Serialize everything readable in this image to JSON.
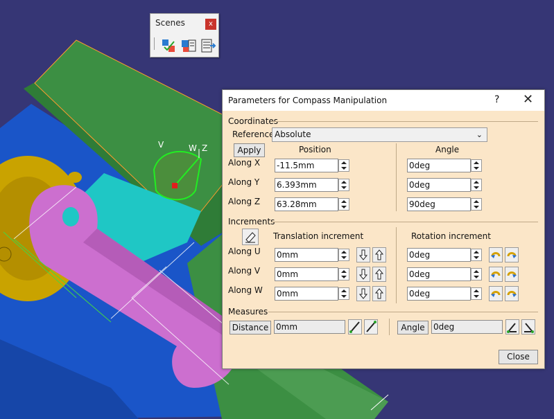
{
  "colors": {
    "background": "#363675",
    "dialog_bg": "#fbe6c8",
    "part_green": "#3c8f43",
    "part_blue": "#1a55c8",
    "part_pink": "#cc6fcf",
    "part_cyan": "#1fc7c5",
    "part_yellow": "#c9a300",
    "compass_green": "#22ee22"
  },
  "viewport": {
    "compass_labels": {
      "v": "V",
      "w": "W",
      "z": "Z"
    }
  },
  "scenes": {
    "title": "Scenes",
    "close": "x",
    "tools": [
      "scene-create-icon",
      "scene-edit-icon",
      "scene-list-icon"
    ]
  },
  "dialog": {
    "title": "Parameters for Compass Manipulation",
    "help": "?",
    "close": "✕",
    "coordinates": {
      "section": "Coordinates",
      "reference_label": "Reference",
      "reference_value": "Absolute",
      "apply": "Apply",
      "position_header": "Position",
      "angle_header": "Angle",
      "rows": [
        {
          "label": "Along X",
          "position": "-11.5mm",
          "angle": "0deg"
        },
        {
          "label": "Along Y",
          "position": "6.393mm",
          "angle": "0deg"
        },
        {
          "label": "Along Z",
          "position": "63.28mm",
          "angle": "90deg"
        }
      ]
    },
    "increments": {
      "section": "Increments",
      "translation_header": "Translation increment",
      "rotation_header": "Rotation increment",
      "rows": [
        {
          "label": "Along U",
          "translation": "0mm",
          "rotation": "0deg"
        },
        {
          "label": "Along V",
          "translation": "0mm",
          "rotation": "0deg"
        },
        {
          "label": "Along W",
          "translation": "0mm",
          "rotation": "0deg"
        }
      ]
    },
    "measures": {
      "section": "Measures",
      "distance_button": "Distance",
      "distance_value": "0mm",
      "angle_button": "Angle",
      "angle_value": "0deg"
    },
    "close_button": "Close"
  }
}
